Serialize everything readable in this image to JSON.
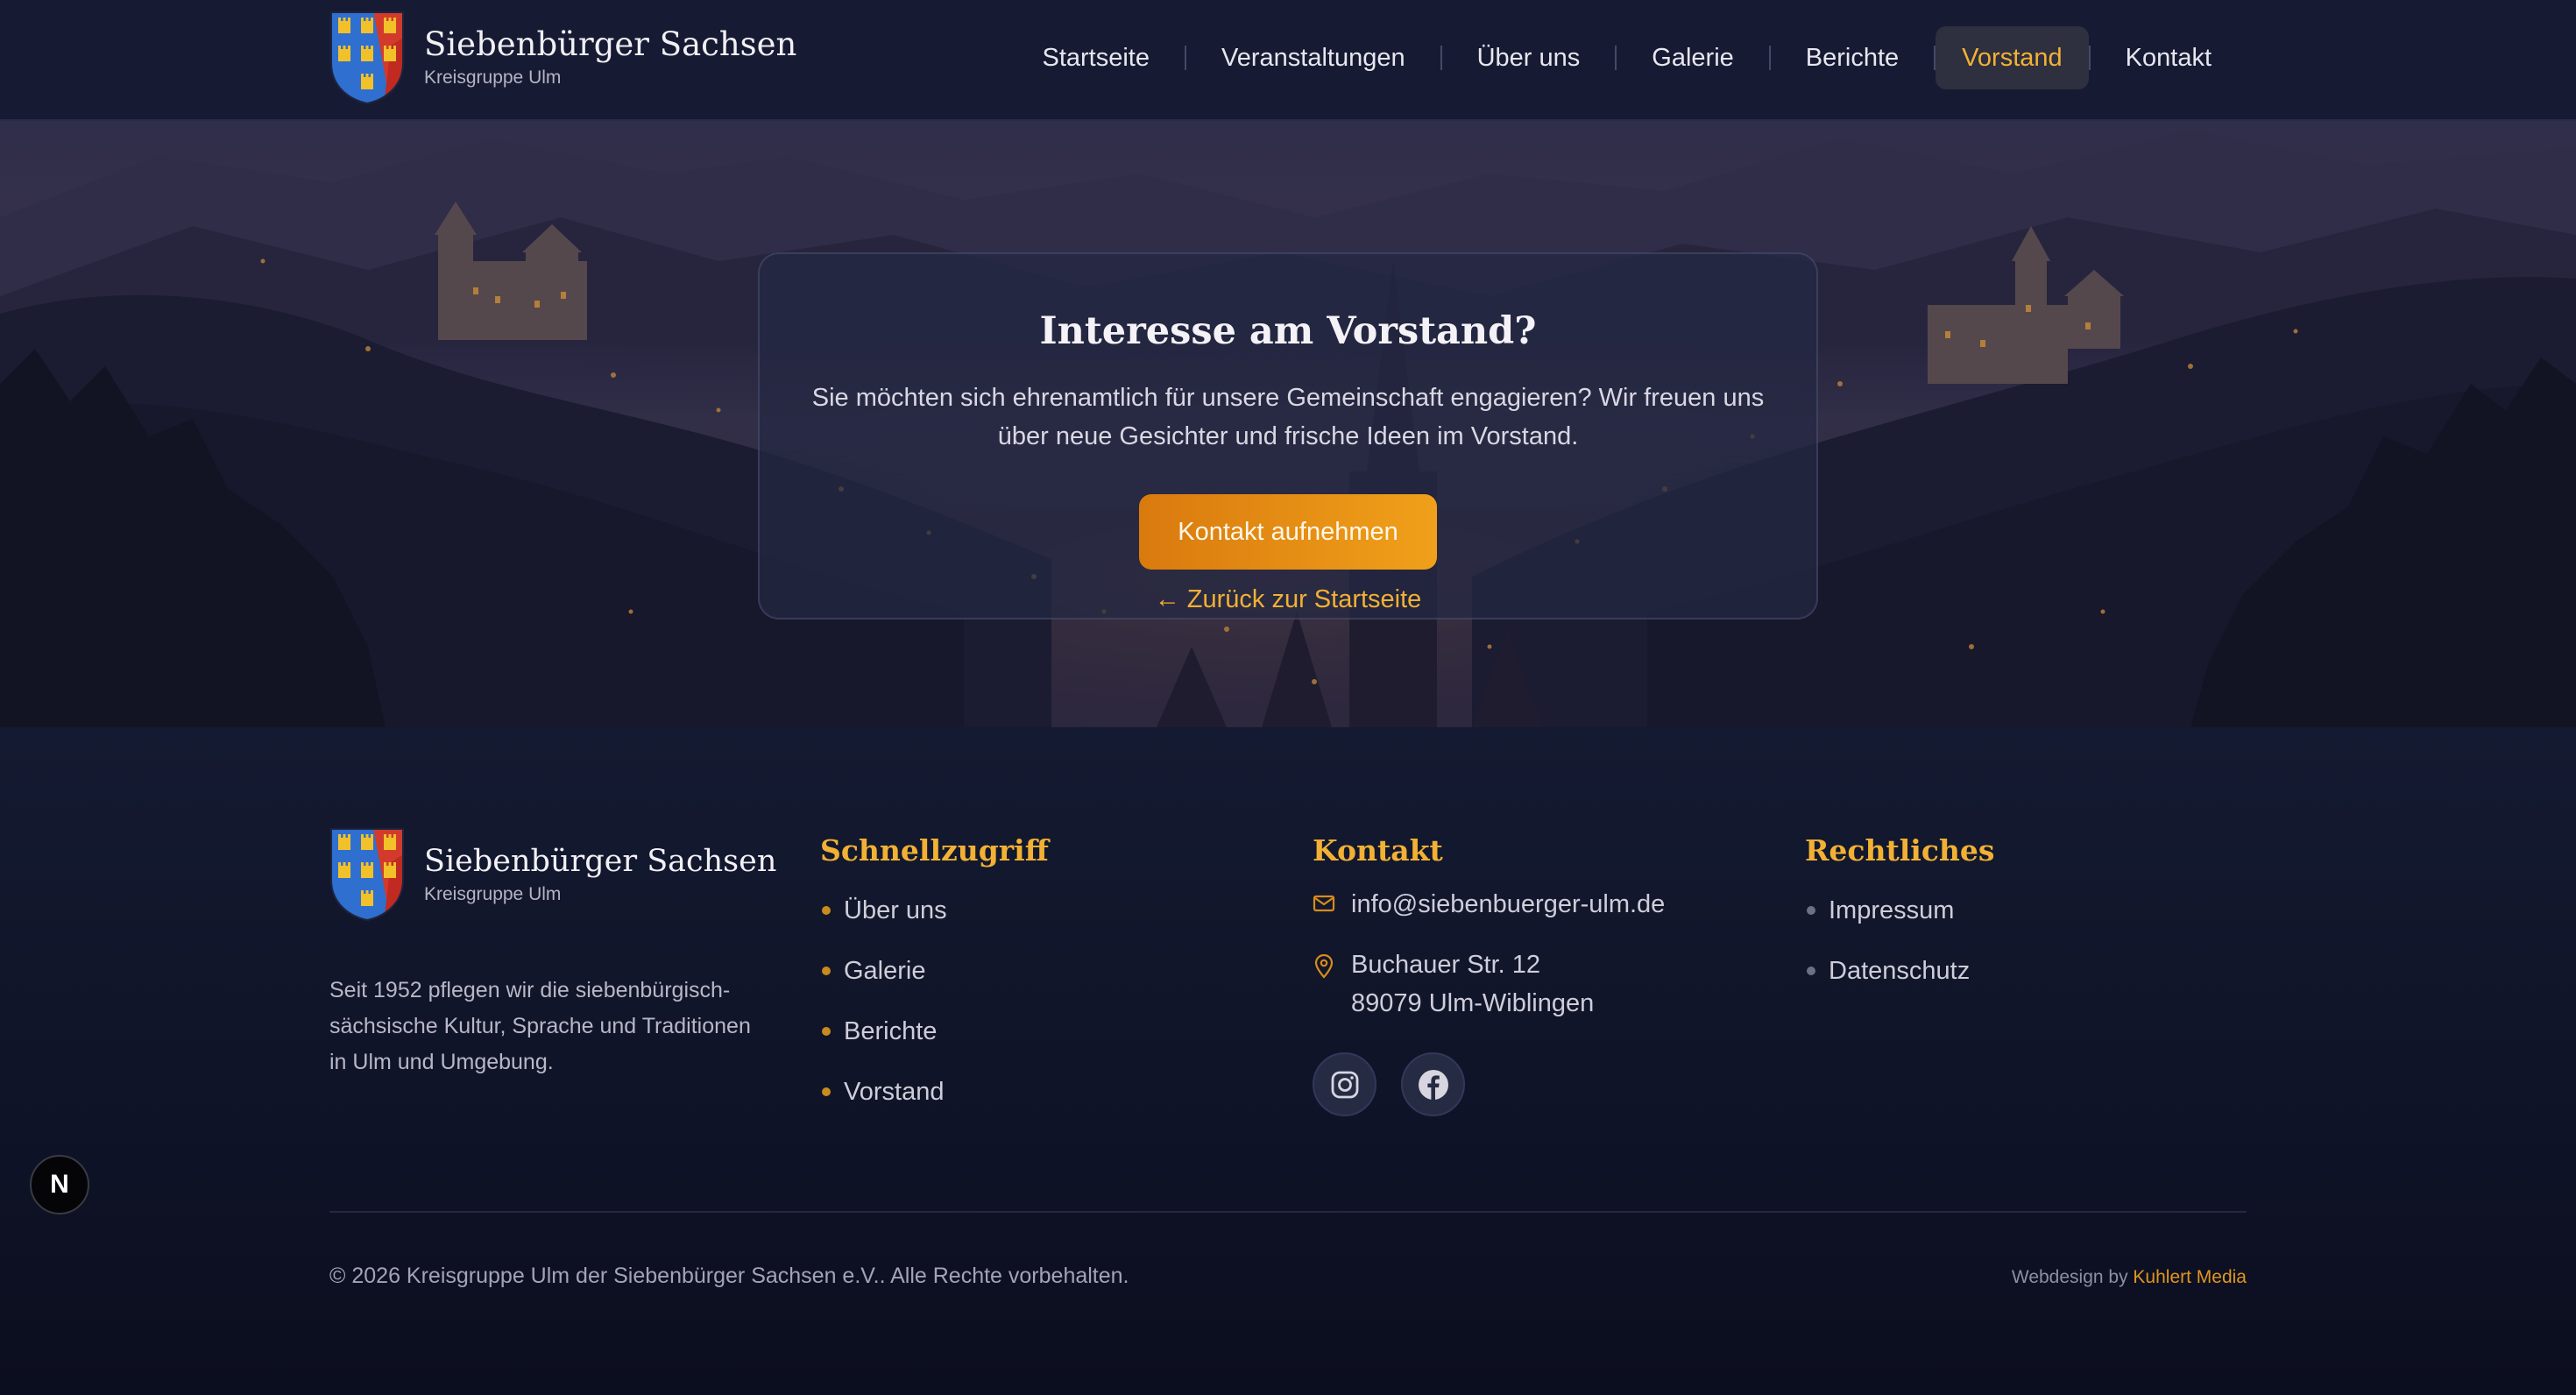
{
  "header": {
    "brand_title": "Siebenbürger Sachsen",
    "brand_subtitle": "Kreisgruppe Ulm",
    "nav": [
      {
        "label": "Startseite"
      },
      {
        "label": "Veranstaltungen"
      },
      {
        "label": "Über uns"
      },
      {
        "label": "Galerie"
      },
      {
        "label": "Berichte"
      },
      {
        "label": "Vorstand",
        "active": true
      },
      {
        "label": "Kontakt"
      }
    ]
  },
  "hero": {
    "cta_title": "Interesse am Vorstand?",
    "cta_text": "Sie möchten sich ehrenamtlich für unsere Gemeinschaft engagieren? Wir freuen uns über neue Gesichter und frische Ideen im Vorstand.",
    "cta_button": "Kontakt aufnehmen",
    "back_link": "← Zurück zur Startseite"
  },
  "footer": {
    "brand_title": "Siebenbürger Sachsen",
    "brand_subtitle": "Kreisgruppe Ulm",
    "description": "Seit 1952 pflegen wir die siebenbürgisch-sächsische Kultur, Sprache und Traditionen in Ulm und Umgebung.",
    "quick": {
      "title": "Schnellzugriff",
      "items": [
        "Über uns",
        "Galerie",
        "Berichte",
        "Vorstand"
      ]
    },
    "contact": {
      "title": "Kontakt",
      "email": "info@siebenbuerger-ulm.de",
      "address_line1": "Buchauer Str. 12",
      "address_line2": "89079 Ulm-Wiblingen",
      "social": [
        {
          "icon": "instagram-icon"
        },
        {
          "icon": "facebook-icon"
        }
      ]
    },
    "legal": {
      "title": "Rechtliches",
      "items": [
        "Impressum",
        "Datenschutz"
      ]
    },
    "copyright": "© 2026 Kreisgruppe Ulm der Siebenbürger Sachsen e.V.. Alle Rechte vorbehalten.",
    "credit_prefix": "Webdesign by",
    "credit_link": "Kuhlert Media"
  },
  "dev_badge": "N",
  "colors": {
    "accent": "#f2b134",
    "button_gradient_start": "#d97a0e",
    "button_gradient_end": "#f0a01a",
    "header_bg": "#161b33",
    "footer_bg": "#0f1327"
  }
}
